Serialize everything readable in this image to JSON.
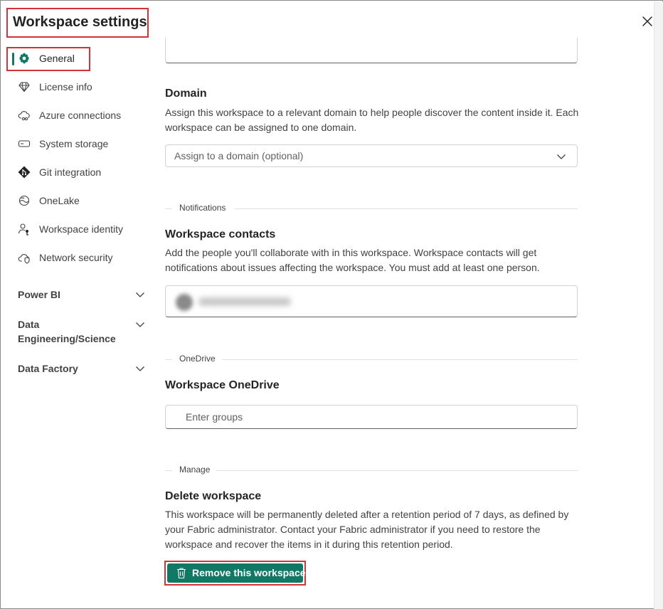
{
  "dialog": {
    "title": "Workspace settings",
    "close_label": "Close"
  },
  "sidebar": {
    "items": [
      {
        "label": "General",
        "icon": "gear-icon",
        "active": true
      },
      {
        "label": "License info",
        "icon": "diamond-icon"
      },
      {
        "label": "Azure connections",
        "icon": "cloud-link-icon"
      },
      {
        "label": "System storage",
        "icon": "storage-icon"
      },
      {
        "label": "Git integration",
        "icon": "git-icon"
      },
      {
        "label": "OneLake",
        "icon": "onelake-icon"
      },
      {
        "label": "Workspace identity",
        "icon": "person-key-icon"
      },
      {
        "label": "Network security",
        "icon": "cloud-shield-icon"
      }
    ],
    "groups": [
      {
        "label": "Power BI"
      },
      {
        "label": "Data Engineering/Science"
      },
      {
        "label": "Data Factory"
      }
    ]
  },
  "domain": {
    "heading": "Domain",
    "description": "Assign this workspace to a relevant domain to help people discover the content inside it. Each workspace can be assigned to one domain.",
    "dropdown_placeholder": "Assign to a domain (optional)"
  },
  "notifications": {
    "section_label": "Notifications",
    "heading": "Workspace contacts",
    "description": "Add the people you'll collaborate with in this workspace. Workspace contacts will get notifications about issues affecting the workspace. You must add at least one person."
  },
  "onedrive": {
    "section_label": "OneDrive",
    "heading": "Workspace OneDrive",
    "input_placeholder": "Enter groups"
  },
  "manage": {
    "section_label": "Manage",
    "heading": "Delete workspace",
    "description": "This workspace will be permanently deleted after a retention period of 7 days, as defined by your Fabric administrator. Contact your Fabric administrator if you need to restore the workspace and recover the items in it during this retention period.",
    "remove_button": "Remove this workspace"
  },
  "colors": {
    "accent": "#117865",
    "highlight": "#d13438"
  }
}
